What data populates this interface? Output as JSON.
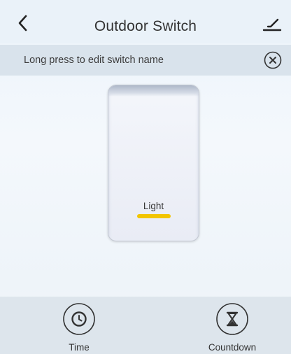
{
  "header": {
    "title": "Outdoor Switch",
    "back_icon": "chevron-left-icon",
    "edit_icon": "edit-icon"
  },
  "banner": {
    "text": "Long press to edit switch name",
    "close_icon": "close-circle-icon"
  },
  "switch": {
    "label": "Light",
    "indicator_color": "#f2c500"
  },
  "toolbar": {
    "items": [
      {
        "label": "Time",
        "icon": "clock-icon"
      },
      {
        "label": "Countdown",
        "icon": "hourglass-icon"
      }
    ]
  }
}
